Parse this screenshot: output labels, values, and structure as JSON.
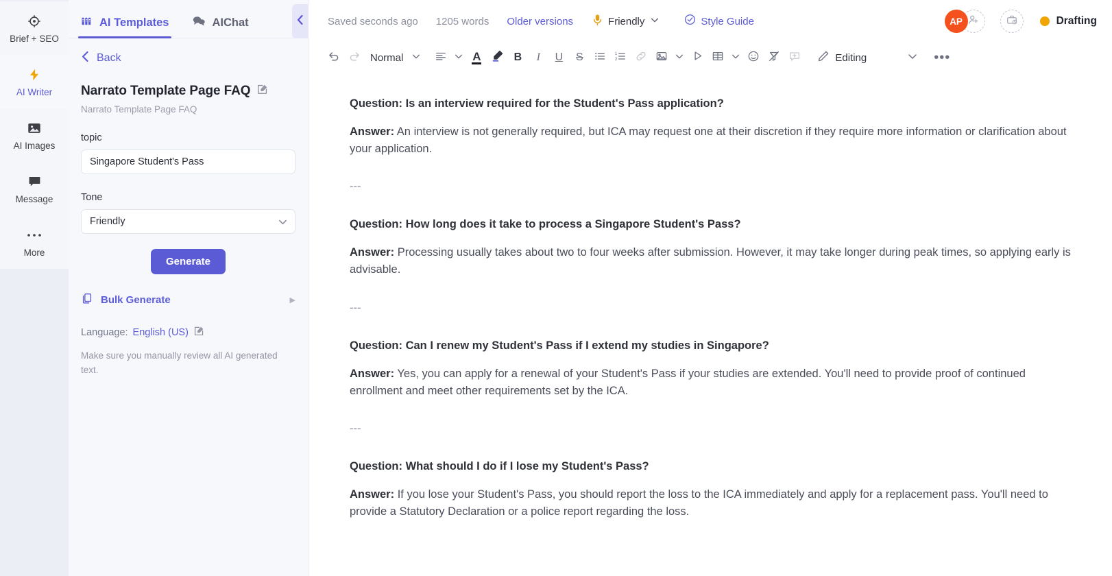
{
  "rail": {
    "items": [
      {
        "label": "Brief + SEO",
        "icon": "target-icon",
        "state": "default"
      },
      {
        "label": "AI Writer",
        "icon": "lightning-icon",
        "state": "active"
      },
      {
        "label": "AI Images",
        "icon": "image-icon",
        "state": "default"
      },
      {
        "label": "Message",
        "icon": "chat-bubble-icon",
        "state": "default"
      },
      {
        "label": "More",
        "icon": "ellipsis-icon",
        "state": "default"
      }
    ]
  },
  "panel": {
    "tabs": [
      {
        "label": "AI Templates",
        "icon": "templates-grid-icon",
        "active": true
      },
      {
        "label": "AIChat",
        "icon": "chat-bubbles-icon",
        "active": false
      }
    ],
    "back_label": "Back",
    "template_title": "Narrato Template Page FAQ",
    "template_subtitle": "Narrato Template Page FAQ",
    "fields": {
      "topic_label": "topic",
      "topic_value": "Singapore Student's Pass",
      "topic_placeholder": "Singapore Student's Pass",
      "tone_label": "Tone",
      "tone_value": "Friendly"
    },
    "generate_label": "Generate",
    "bulk_generate_label": "Bulk Generate",
    "language_prefix": "Language:",
    "language_value": "English (US)",
    "disclaimer": "Make sure you manually review all AI generated text."
  },
  "topbar": {
    "saved_status": "Saved seconds ago",
    "word_count": "1205 words",
    "older_versions": "Older versions",
    "tone": "Friendly",
    "style_guide": "Style Guide",
    "avatar_initials": "AP",
    "status_label": "Drafting",
    "status_color": "#f0a500",
    "accent_color": "#5b5bd6",
    "avatar_color": "#f4511e"
  },
  "toolbar": {
    "undo": "undo-icon",
    "redo": "redo-icon",
    "paragraph_style": "Normal",
    "align": "align-left-icon",
    "font_color": "A",
    "highlight": "highlighter-icon",
    "bold": "B",
    "italic": "I",
    "underline": "U",
    "strikethrough": "S",
    "bullet_list": "bullet-list-icon",
    "numbered_list": "numbered-list-icon",
    "link": "link-icon",
    "image": "image-icon",
    "video": "play-icon",
    "table": "table-icon",
    "emoji": "emoji-icon",
    "clear_format": "clear-format-icon",
    "comment": "add-comment-icon",
    "editing_mode": "Editing",
    "more": "•••"
  },
  "document": {
    "blocks": [
      {
        "type": "qa",
        "question": "Question: Is an interview required for the Student's Pass application?",
        "answer_label": "Answer:",
        "answer": "An interview is not generally required, but ICA may request one at their discretion if they require more information or clarification about your application."
      },
      {
        "type": "divider",
        "text": "---"
      },
      {
        "type": "qa",
        "question": "Question: How long does it take to process a Singapore Student's Pass?",
        "answer_label": "Answer:",
        "answer": "Processing usually takes about two to four weeks after submission. However, it may take longer during peak times, so applying early is advisable."
      },
      {
        "type": "divider",
        "text": "---"
      },
      {
        "type": "qa",
        "question": "Question: Can I renew my Student's Pass if I extend my studies in Singapore?",
        "answer_label": "Answer:",
        "answer": "Yes, you can apply for a renewal of your Student's Pass if your studies are extended. You'll need to provide proof of continued enrollment and meet other requirements set by the ICA."
      },
      {
        "type": "divider",
        "text": "---"
      },
      {
        "type": "qa",
        "question": "Question: What should I do if I lose my Student's Pass?",
        "answer_label": "Answer:",
        "answer": "If you lose your Student's Pass, you should report the loss to the ICA immediately and apply for a replacement pass. You'll need to provide a Statutory Declaration or a police report regarding the loss."
      }
    ]
  }
}
